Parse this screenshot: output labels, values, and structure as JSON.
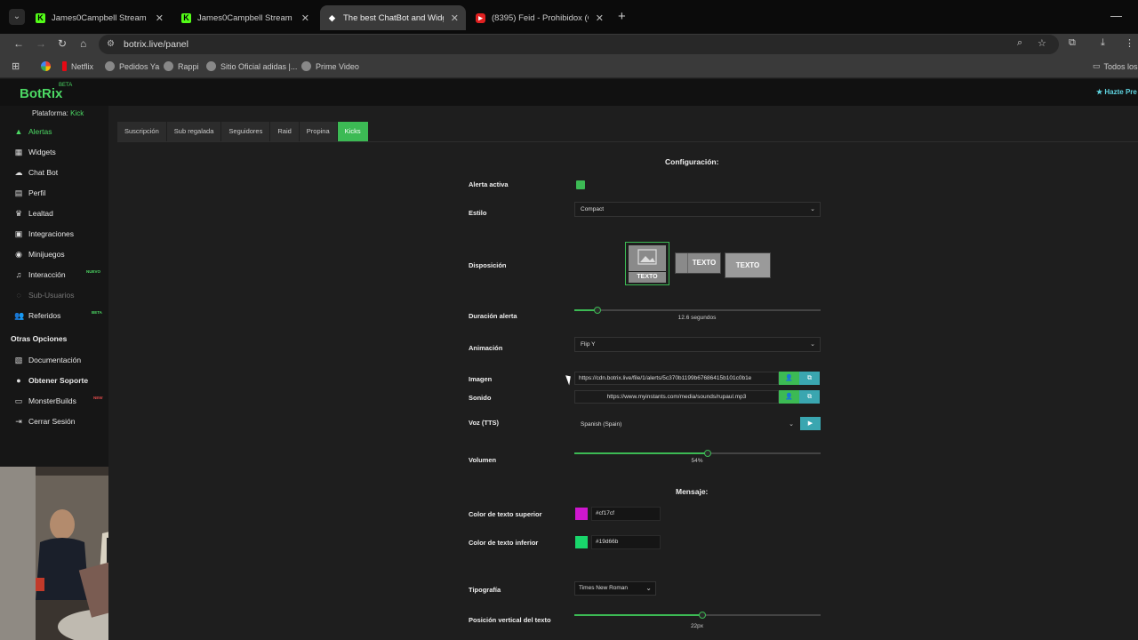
{
  "browser": {
    "tabs": [
      {
        "title": "James0Campbell Stream - Wat",
        "icon": "kick-icon"
      },
      {
        "title": "James0Campbell Stream - Kick",
        "icon": "kick-icon"
      },
      {
        "title": "The best ChatBot and Widgets",
        "icon": "botrix-icon"
      },
      {
        "title": "(8395) Feid - Prohibidox (Offici",
        "icon": "youtube-icon"
      }
    ],
    "url": "botrix.live/panel",
    "bookmarks": [
      "Netflix",
      "Pedidos Ya",
      "Rappi",
      "Sitio Oficial adidas |...",
      "Prime Video"
    ],
    "all_bookmarks_label": "Todos los"
  },
  "app": {
    "logo": "BotRix",
    "logo_badge": "BETA",
    "premium": "Hazte Pre",
    "platform_label": "Plataforma:",
    "platform_value": "Kick"
  },
  "sidebar": {
    "items": [
      {
        "label": "Alertas",
        "icon": "alert-triangle-icon"
      },
      {
        "label": "Widgets",
        "icon": "widgets-grid-icon"
      },
      {
        "label": "Chat Bot",
        "icon": "cloud-icon"
      },
      {
        "label": "Perfil",
        "icon": "profile-card-icon"
      },
      {
        "label": "Lealtad",
        "icon": "trophy-icon"
      },
      {
        "label": "Integraciones",
        "icon": "integrations-icon"
      },
      {
        "label": "Minijuegos",
        "icon": "gamepad-icon"
      },
      {
        "label": "Interacción",
        "icon": "music-note-icon",
        "badge": "NUEVO"
      },
      {
        "label": "Sub-Usuarios",
        "icon": "sub-users-icon"
      },
      {
        "label": "Referidos",
        "icon": "users-icon",
        "badge": "BETA"
      }
    ],
    "other_title": "Otras Opciones",
    "other_items": [
      {
        "label": "Documentación",
        "icon": "docs-icon"
      },
      {
        "label": "Obtener Soporte",
        "icon": "support-icon"
      },
      {
        "label": "MonsterBuilds",
        "icon": "monitor-icon",
        "badge": "NEW"
      },
      {
        "label": "Cerrar Sesión",
        "icon": "logout-icon"
      }
    ]
  },
  "subtabs": [
    "Suscripción",
    "Sub regalada",
    "Seguidores",
    "Raid",
    "Propina",
    "Kicks"
  ],
  "config": {
    "title": "Configuración:",
    "alerta_activa_label": "Alerta activa",
    "estilo_label": "Estilo",
    "estilo_value": "Compact",
    "disposicion_label": "Disposición",
    "layout_text": "TEXTO",
    "duracion_label": "Duración alerta",
    "duracion_value": "12.6 segundos",
    "duracion_fraction": 0.095,
    "animacion_label": "Animación",
    "animacion_value": "Flip Y",
    "imagen_label": "Imagen",
    "imagen_url": "https://cdn.botrix.live/file/1/alerts/5c370b1199b67686415b101c0b1e",
    "sonido_label": "Sonido",
    "sonido_url": "https://www.myinstants.com/media/sounds/rupaul.mp3",
    "voz_label": "Voz (TTS)",
    "voz_value": "Spanish (Spain)",
    "volumen_label": "Volumen",
    "volumen_value": "54%",
    "volumen_fraction": 0.54
  },
  "message": {
    "title": "Mensaje:",
    "top_color_label": "Color de texto superior",
    "top_color": "#cf17cf",
    "bottom_color_label": "Color de texto inferior",
    "bottom_color": "#19d66b",
    "typography_label": "Tipografía",
    "typography_value": "Times New Roman",
    "vertical_pos_label": "Posición vertical del texto",
    "vertical_pos_value": "22px",
    "vertical_pos_fraction": 0.52
  },
  "colors": {
    "accent": "#3cba54",
    "teal": "#3aa6b0"
  }
}
